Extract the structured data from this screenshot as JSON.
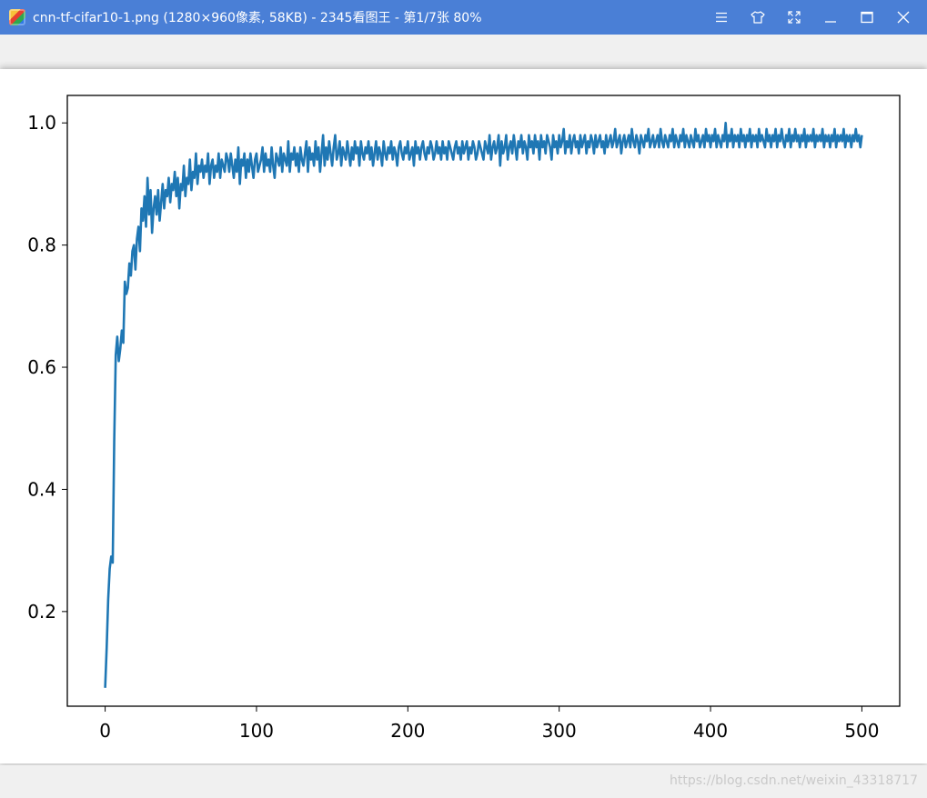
{
  "window": {
    "title": "cnn-tf-cifar10-1.png  (1280×960像素, 58KB)  - 2345看图王 - 第1/7张 80%",
    "controls": [
      "menu-icon",
      "skin-icon",
      "fullscreen-icon",
      "minimize-icon",
      "maximize-icon",
      "close-icon"
    ]
  },
  "watermark": "https://blog.csdn.net/weixin_43318717",
  "colors": {
    "titlebar": "#4a7fd6",
    "line": "#1f77b4"
  },
  "chart_data": {
    "type": "line",
    "title": "",
    "xlabel": "",
    "ylabel": "",
    "xlim": [
      -25,
      525
    ],
    "ylim": [
      0.045,
      1.045
    ],
    "xticks": [
      0,
      100,
      200,
      300,
      400,
      500
    ],
    "xtick_labels": [
      "0",
      "100",
      "200",
      "300",
      "400",
      "500"
    ],
    "yticks": [
      0.2,
      0.4,
      0.6,
      0.8,
      1.0
    ],
    "ytick_labels": [
      "0.2",
      "0.4",
      "0.6",
      "0.8",
      "1.0"
    ],
    "grid": false,
    "series": [
      {
        "x_start": 0,
        "x_step": 1,
        "values": [
          0.075,
          0.14,
          0.22,
          0.27,
          0.29,
          0.28,
          0.48,
          0.62,
          0.65,
          0.61,
          0.63,
          0.66,
          0.64,
          0.74,
          0.72,
          0.73,
          0.77,
          0.75,
          0.79,
          0.8,
          0.76,
          0.81,
          0.83,
          0.79,
          0.86,
          0.84,
          0.88,
          0.83,
          0.91,
          0.85,
          0.89,
          0.82,
          0.86,
          0.88,
          0.85,
          0.89,
          0.84,
          0.87,
          0.9,
          0.86,
          0.89,
          0.88,
          0.91,
          0.87,
          0.9,
          0.89,
          0.92,
          0.88,
          0.91,
          0.86,
          0.9,
          0.89,
          0.93,
          0.88,
          0.91,
          0.9,
          0.94,
          0.89,
          0.92,
          0.91,
          0.95,
          0.9,
          0.93,
          0.92,
          0.94,
          0.91,
          0.93,
          0.92,
          0.95,
          0.9,
          0.93,
          0.94,
          0.91,
          0.93,
          0.92,
          0.95,
          0.91,
          0.94,
          0.93,
          0.92,
          0.95,
          0.94,
          0.92,
          0.95,
          0.93,
          0.91,
          0.94,
          0.92,
          0.96,
          0.9,
          0.94,
          0.93,
          0.95,
          0.91,
          0.94,
          0.92,
          0.95,
          0.93,
          0.91,
          0.94,
          0.95,
          0.92,
          0.93,
          0.94,
          0.96,
          0.92,
          0.95,
          0.93,
          0.94,
          0.92,
          0.96,
          0.93,
          0.91,
          0.95,
          0.94,
          0.93,
          0.96,
          0.92,
          0.95,
          0.94,
          0.93,
          0.97,
          0.92,
          0.95,
          0.94,
          0.96,
          0.93,
          0.95,
          0.92,
          0.96,
          0.94,
          0.93,
          0.95,
          0.97,
          0.92,
          0.96,
          0.94,
          0.95,
          0.93,
          0.97,
          0.94,
          0.96,
          0.92,
          0.95,
          0.98,
          0.93,
          0.96,
          0.94,
          0.97,
          0.95,
          0.93,
          0.96,
          0.98,
          0.94,
          0.95,
          0.97,
          0.93,
          0.96,
          0.95,
          0.94,
          0.97,
          0.95,
          0.93,
          0.96,
          0.94,
          0.97,
          0.95,
          0.96,
          0.93,
          0.97,
          0.95,
          0.94,
          0.96,
          0.95,
          0.97,
          0.94,
          0.96,
          0.93,
          0.95,
          0.97,
          0.94,
          0.96,
          0.95,
          0.93,
          0.97,
          0.95,
          0.94,
          0.96,
          0.95,
          0.97,
          0.94,
          0.96,
          0.95,
          0.93,
          0.96,
          0.97,
          0.95,
          0.94,
          0.96,
          0.95,
          0.97,
          0.94,
          0.95,
          0.96,
          0.93,
          0.97,
          0.95,
          0.96,
          0.94,
          0.96,
          0.97,
          0.95,
          0.94,
          0.96,
          0.95,
          0.97,
          0.96,
          0.94,
          0.95,
          0.97,
          0.95,
          0.96,
          0.94,
          0.97,
          0.95,
          0.96,
          0.94,
          0.97,
          0.96,
          0.95,
          0.94,
          0.96,
          0.97,
          0.95,
          0.96,
          0.94,
          0.97,
          0.95,
          0.96,
          0.97,
          0.94,
          0.96,
          0.95,
          0.97,
          0.96,
          0.94,
          0.95,
          0.97,
          0.96,
          0.95,
          0.94,
          0.97,
          0.96,
          0.95,
          0.98,
          0.94,
          0.96,
          0.97,
          0.95,
          0.96,
          0.98,
          0.93,
          0.97,
          0.95,
          0.96,
          0.98,
          0.94,
          0.96,
          0.97,
          0.95,
          0.98,
          0.96,
          0.94,
          0.97,
          0.96,
          0.98,
          0.95,
          0.97,
          0.96,
          0.94,
          0.98,
          0.96,
          0.97,
          0.95,
          0.98,
          0.96,
          0.97,
          0.94,
          0.98,
          0.96,
          0.97,
          0.95,
          0.98,
          0.97,
          0.96,
          0.94,
          0.98,
          0.96,
          0.97,
          0.95,
          0.98,
          0.96,
          0.97,
          0.99,
          0.95,
          0.97,
          0.96,
          0.98,
          0.95,
          0.97,
          0.98,
          0.96,
          0.97,
          0.95,
          0.98,
          0.96,
          0.97,
          0.98,
          0.95,
          0.97,
          0.96,
          0.98,
          0.97,
          0.95,
          0.98,
          0.96,
          0.97,
          0.98,
          0.96,
          0.97,
          0.95,
          0.98,
          0.96,
          0.97,
          0.98,
          0.96,
          0.97,
          0.99,
          0.96,
          0.97,
          0.98,
          0.95,
          0.97,
          0.98,
          0.96,
          0.97,
          0.98,
          0.96,
          0.99,
          0.97,
          0.96,
          0.98,
          0.97,
          0.95,
          0.98,
          0.97,
          0.96,
          0.98,
          0.97,
          0.99,
          0.96,
          0.97,
          0.98,
          0.96,
          0.97,
          0.98,
          0.96,
          0.99,
          0.97,
          0.96,
          0.98,
          0.97,
          0.96,
          0.98,
          0.97,
          0.99,
          0.96,
          0.98,
          0.97,
          0.96,
          0.98,
          0.97,
          0.99,
          0.96,
          0.98,
          0.97,
          0.96,
          0.98,
          0.97,
          0.96,
          0.99,
          0.97,
          0.98,
          0.96,
          0.97,
          0.98,
          0.96,
          0.99,
          0.97,
          0.98,
          0.96,
          0.98,
          0.97,
          0.99,
          0.96,
          0.98,
          0.97,
          0.96,
          0.98,
          0.97,
          1.0,
          0.96,
          0.98,
          0.97,
          0.99,
          0.96,
          0.98,
          0.97,
          0.98,
          0.96,
          0.99,
          0.97,
          0.98,
          0.96,
          0.98,
          0.97,
          0.99,
          0.96,
          0.98,
          0.97,
          0.98,
          0.96,
          0.99,
          0.97,
          0.98,
          0.97,
          0.96,
          0.99,
          0.97,
          0.98,
          0.96,
          0.98,
          0.97,
          0.99,
          0.96,
          0.98,
          0.97,
          0.99,
          0.97,
          0.96,
          0.98,
          0.97,
          0.99,
          0.96,
          0.98,
          0.97,
          0.99,
          0.97,
          0.98,
          0.96,
          0.98,
          0.97,
          0.99,
          0.96,
          0.98,
          0.97,
          0.98,
          0.97,
          0.99,
          0.96,
          0.98,
          0.97,
          0.98,
          0.97,
          0.99,
          0.96,
          0.98,
          0.97,
          0.98,
          0.96,
          0.98,
          0.97,
          0.99,
          0.96,
          0.98,
          0.97,
          0.98,
          0.97,
          0.99,
          0.96,
          0.98,
          0.97,
          0.98,
          0.96,
          0.98,
          0.97,
          0.99,
          0.97,
          0.98,
          0.96,
          0.98
        ]
      }
    ]
  }
}
